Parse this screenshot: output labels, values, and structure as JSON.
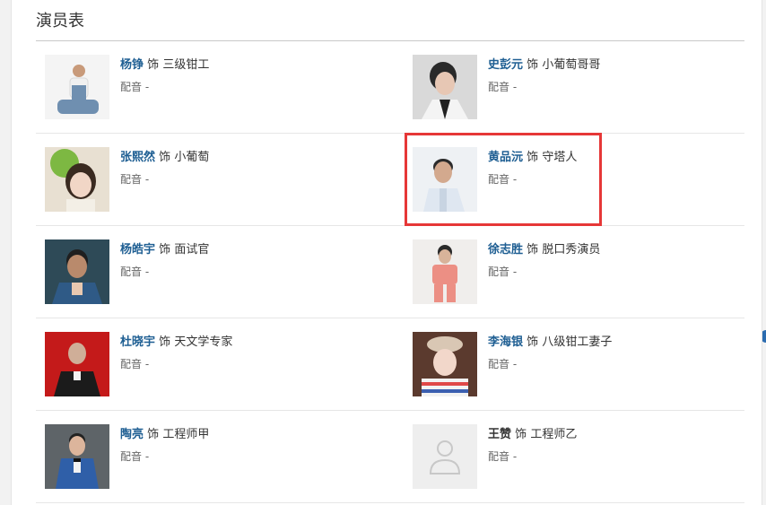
{
  "section": {
    "title": "演员表"
  },
  "cast": [
    {
      "actor": "杨铮",
      "connector": "饰",
      "role": "三级钳工",
      "voice_label": "配音",
      "voice_value": "-",
      "photo": "actor-photo",
      "linked": true
    },
    {
      "actor": "史彭元",
      "connector": "饰",
      "role": "小葡萄哥哥",
      "voice_label": "配音",
      "voice_value": "-",
      "photo": "actor-photo",
      "linked": true
    },
    {
      "actor": "张熙然",
      "connector": "饰",
      "role": "小葡萄",
      "voice_label": "配音",
      "voice_value": "-",
      "photo": "actor-photo",
      "linked": true
    },
    {
      "actor": "黄品沅",
      "connector": "饰",
      "role": "守塔人",
      "voice_label": "配音",
      "voice_value": "-",
      "photo": "actor-photo",
      "linked": true
    },
    {
      "actor": "杨皓宇",
      "connector": "饰",
      "role": "面试官",
      "voice_label": "配音",
      "voice_value": "-",
      "photo": "actor-photo",
      "linked": true
    },
    {
      "actor": "徐志胜",
      "connector": "饰",
      "role": "脱口秀演员",
      "voice_label": "配音",
      "voice_value": "-",
      "photo": "actor-photo",
      "linked": true
    },
    {
      "actor": "杜晓宇",
      "connector": "饰",
      "role": "天文学专家",
      "voice_label": "配音",
      "voice_value": "-",
      "photo": "actor-photo",
      "linked": true
    },
    {
      "actor": "李海银",
      "connector": "饰",
      "role": "八级钳工妻子",
      "voice_label": "配音",
      "voice_value": "-",
      "photo": "actor-photo",
      "linked": true
    },
    {
      "actor": "陶亮",
      "connector": "饰",
      "role": "工程师甲",
      "voice_label": "配音",
      "voice_value": "-",
      "photo": "actor-photo",
      "linked": true
    },
    {
      "actor": "王赞",
      "connector": "饰",
      "role": "工程师乙",
      "voice_label": "配音",
      "voice_value": "-",
      "photo": "avatar-placeholder-icon",
      "linked": false
    }
  ],
  "highlight": {
    "entry": "黄品沅",
    "color": "#e63737"
  },
  "colors": {
    "link": "#1f5f93",
    "text": "#333333",
    "muted": "#666666",
    "divider": "#e6e6e6"
  }
}
